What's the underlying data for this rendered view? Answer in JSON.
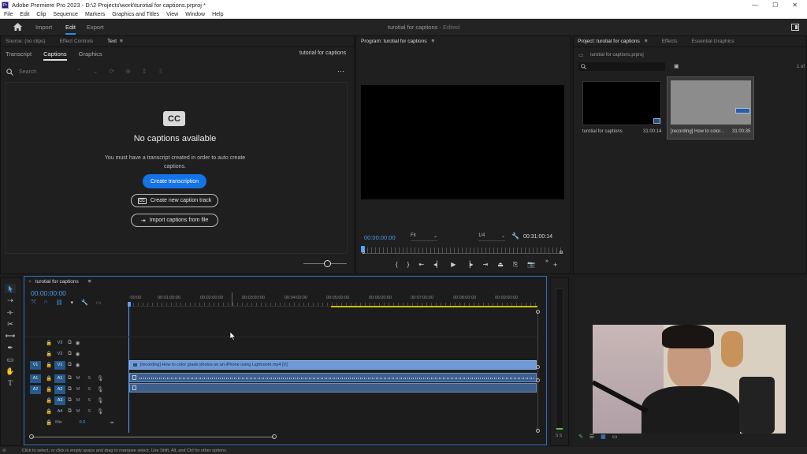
{
  "window": {
    "app_icon": "Pr",
    "title": "Adobe Premiere Pro 2023 - D:\\2 Projects\\work\\turotial for captions.prproj *",
    "minimize": "—",
    "maximize": "☐",
    "close": "✕"
  },
  "menu": [
    "File",
    "Edit",
    "Clip",
    "Sequence",
    "Markers",
    "Graphics and Titles",
    "View",
    "Window",
    "Help"
  ],
  "workspaces": {
    "import": "Import",
    "edit": "Edit",
    "export": "Export",
    "project_title": "turotial for captions",
    "status": "- Edited"
  },
  "left_panel": {
    "tabs": [
      "Source: (no clips)",
      "Effect Controls",
      "Text"
    ],
    "subtabs": [
      "Transcript",
      "Captions",
      "Graphics"
    ],
    "sequence_name": "tutorial for captions",
    "search_placeholder": "Search",
    "cc_badge": "CC",
    "empty_title": "No captions available",
    "empty_desc": "You must have a transcript created in order to auto create captions.",
    "create_transcription": "Create transcription",
    "create_caption_track": "Create new caption track",
    "import_captions": "Import captions from file",
    "cc_small": "CC",
    "zoom_level": 0.55
  },
  "program": {
    "tab": "Program: turotial for captions",
    "timecode": "00:00:00:00",
    "fit": "Fit",
    "resolution": "1/4",
    "duration": "00:31:00:14"
  },
  "project": {
    "tabs": [
      "Project: turotial for captions",
      "Effects",
      "Essential Graphics"
    ],
    "file": "turotial for captions.prproj",
    "count": "1 of",
    "items": [
      {
        "name": "turotial for captions",
        "duration": "31:00:14"
      },
      {
        "name": "[recording] How to color...",
        "duration": "31:00:35"
      }
    ]
  },
  "timeline": {
    "tab": "turotial for captions",
    "timecode": "00:00:00:00",
    "ruler": [
      ":00:00",
      "00:01:00:00",
      "00:02:00:00",
      "00:03:00:00",
      "00:04:00:00",
      "00:05:00:00",
      "00:06:00:00",
      "00:07:00:00",
      "00:08:00:00",
      "00:09:00:00"
    ],
    "video_tracks": [
      "V3",
      "V2",
      "V1"
    ],
    "audio_tracks": [
      "A1",
      "A2",
      "A3",
      "A4"
    ],
    "source_v": "V1",
    "source_a": [
      "A1",
      "A2"
    ],
    "mix_label": "Mix",
    "mix_value": "0.0",
    "clip_label": "[recording] How to color grade photos on an iPhone using Lightroom.mp4 [V]",
    "mute": "M",
    "solo": "S",
    "meter_label": "S S"
  },
  "status_bar": "Click to select, or click in empty space and drag to marquee select. Use Shift, Alt, and Ctrl for other options.",
  "colors": {
    "accent": "#1473e6",
    "video_clip": "#6f9ad6",
    "audio_clip": "#3e5f8c",
    "playhead": "#5aa0ff"
  }
}
